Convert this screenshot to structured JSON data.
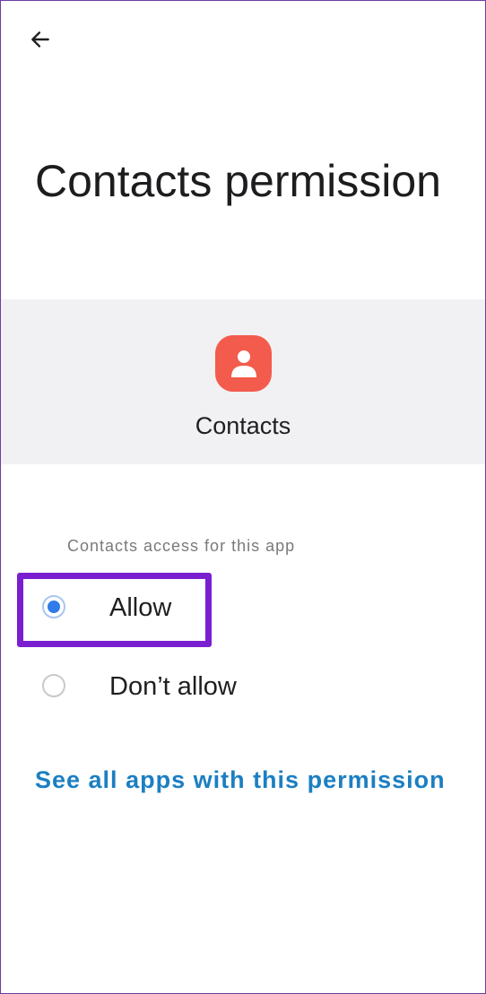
{
  "header": {
    "back_icon": "arrow-left-icon"
  },
  "page": {
    "title": "Contacts permission"
  },
  "app": {
    "name": "Contacts",
    "icon": "contacts-person-icon",
    "icon_color": "#f35b4c",
    "header_bg": "#f1f1f3"
  },
  "permission": {
    "section_label": "Contacts access for this app",
    "options": [
      {
        "label": "Allow",
        "selected": true
      },
      {
        "label": "Don’t allow",
        "selected": false
      }
    ],
    "highlight_color": "#7a1fd0",
    "radio_color": "#2f7bea"
  },
  "footer": {
    "link_label": "See all apps with this permission",
    "link_color": "#1c7fc2"
  }
}
